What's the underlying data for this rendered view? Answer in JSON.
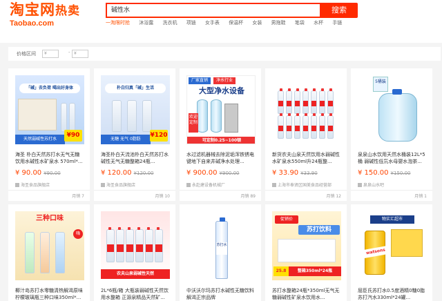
{
  "header": {
    "logo_text": "淘宝网",
    "logo_hot": "热卖",
    "logo_en": "Taobao.com",
    "search_value": "碱性水",
    "search_button": "搜索",
    "hot_links": [
      "一淘限时抢",
      "沐浴露",
      "洗衣机",
      "项链",
      "女手表",
      "保温杯",
      "女装",
      "男拖鞋",
      "笔袋",
      "水杯",
      "手链"
    ]
  },
  "filter": {
    "label": "价格区间",
    "min_placeholder": "¥",
    "max_placeholder": "¥",
    "separator": "-"
  },
  "products": [
    {
      "title": "海圣 朴白天然苏打水无气无糖饮用水碱性水矿泉水 570ml*...",
      "price": "¥ 90.00",
      "orig_price": "¥90.00",
      "shop": "海圣食品旗舰店",
      "sales": "月销 7",
      "img_banner": "「碱」去负荷 喝出好身体",
      "img_bottom_label": "天然弱碱性苏打水",
      "img_price_tag": "¥90"
    },
    {
      "title": "海圣朴白天流池朴白天然苏打水碱性无气无糖整箱24瓶...",
      "price": "¥ 120.00",
      "orig_price": "¥120.00",
      "shop": "海圣食品旗舰店",
      "sales": "月销 10",
      "img_banner": "朴白归真「碱」生活",
      "img_bottom_label": "无糖 无气 0脂肪",
      "img_price_tag": "¥120"
    },
    {
      "title": "水过滤机器械去除泥垢浑铁锈电键地下自来井碱净水处理...",
      "price": "¥ 900.00",
      "orig_price": "¥900.00",
      "shop": "永赴建设备机械厂",
      "sales": "月销 89",
      "img_badge1": "厂家直销",
      "img_badge2": "净水行业",
      "img_headline": "大型净水设备",
      "img_side": "欢迎定制",
      "img_bottom_label": "可定制0.25~100顿"
    },
    {
      "title": "新货农夫山泉天然饮用水弱碱性水矿泉水550ml升24瓶整...",
      "price": "¥ 33.90",
      "orig_price": "¥33.90",
      "shop": "上海市奉贤区国美食品经营部",
      "sales": "月销 12"
    },
    {
      "title": "泉泉山水饮用天然水桶装12L*5桶 弱碱性低氘水母婴水泡茶...",
      "price": "¥ 150.00",
      "orig_price": "¥150.00",
      "shop": "泉泉山水吧",
      "sales": "月销 1",
      "img_corner": "5桶装"
    },
    {
      "title": "椰汁岛苏打水零糖清热解渴原味柠檬玻璃瓶三种口味350ml*...",
      "img_banner": "三种口味",
      "img_corner": "嗨"
    },
    {
      "title": "2L*6瓶/箱 大瓶装弱碱性天然饮用水整箱 正源泉精品天然矿...",
      "img_bottom_label": "农夫山泉弱碱性天然"
    },
    {
      "title": "中沃沃尔玛苏打水碱性无糖饮料解渴正宗品牌",
      "img_bottle_label": "苏打水"
    },
    {
      "title": "苏打水整箱24瓶*350ml无气无糖弱碱性矿泉水饮用水...",
      "img_badge": "促销价",
      "img_headline": "苏打饮料",
      "img_bottom_label": "整箱350ml*24瓶",
      "img_price_tag": "25.8"
    },
    {
      "title": "屈臣氏苏打水0.5度酒精0糖0脂苏打汽水330ml*24罐...",
      "img_badge": "物实汇超市",
      "img_brand": "watsons"
    }
  ],
  "colors": {
    "brand": "#ff5000",
    "search_red": "#ff2a00",
    "price_red": "#ff4400"
  }
}
